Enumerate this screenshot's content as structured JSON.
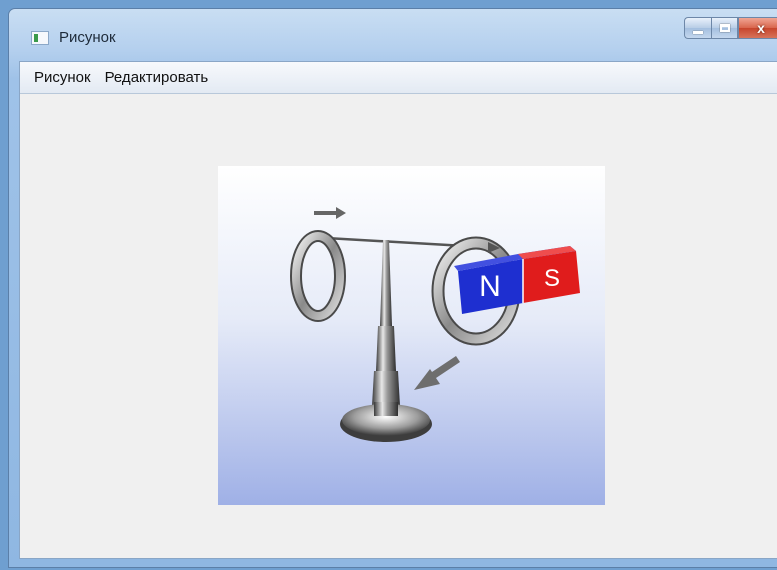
{
  "window": {
    "title": "Рисунок"
  },
  "menu": {
    "items": [
      "Рисунок",
      "Редактировать"
    ]
  },
  "caption_buttons": {
    "close_symbol": "x"
  },
  "figure": {
    "pole_n": "N",
    "pole_s": "S",
    "colors": {
      "north": "#1e2fd0",
      "south": "#e01c1c",
      "background_top": "#ffffff",
      "background_bottom": "#9fb0e6"
    }
  }
}
